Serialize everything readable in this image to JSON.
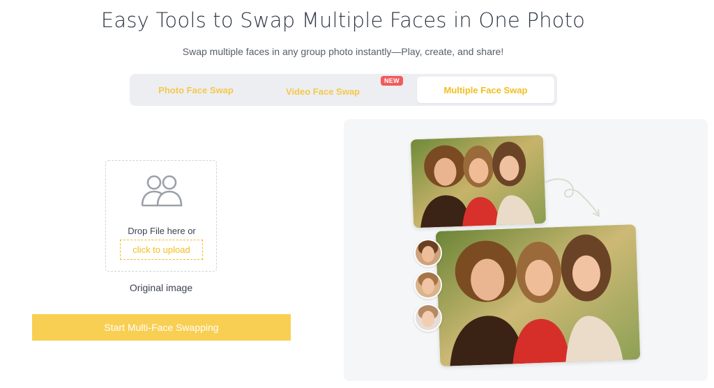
{
  "header": {
    "title": "Easy Tools to Swap Multiple Faces in One Photo",
    "subtitle": "Swap multiple faces in any group photo instantly—Play, create, and share!"
  },
  "tabs": [
    {
      "label": "Photo Face Swap",
      "active": false
    },
    {
      "label": "Video Face Swap",
      "active": false,
      "badge": "NEW"
    },
    {
      "label": "Multiple Face Swap",
      "active": true
    }
  ],
  "upload": {
    "icon": "people-icon",
    "drop_text": "Drop File here or",
    "click_text": "click to upload",
    "caption": "Original image"
  },
  "action": {
    "start_label": "Start Multi-Face Swapping"
  },
  "colors": {
    "accent": "#f2bd1e",
    "button": "#f8cf53",
    "badge": "#f05c5c",
    "tab_bg": "#eceef2",
    "preview_bg": "#f5f6f8"
  }
}
